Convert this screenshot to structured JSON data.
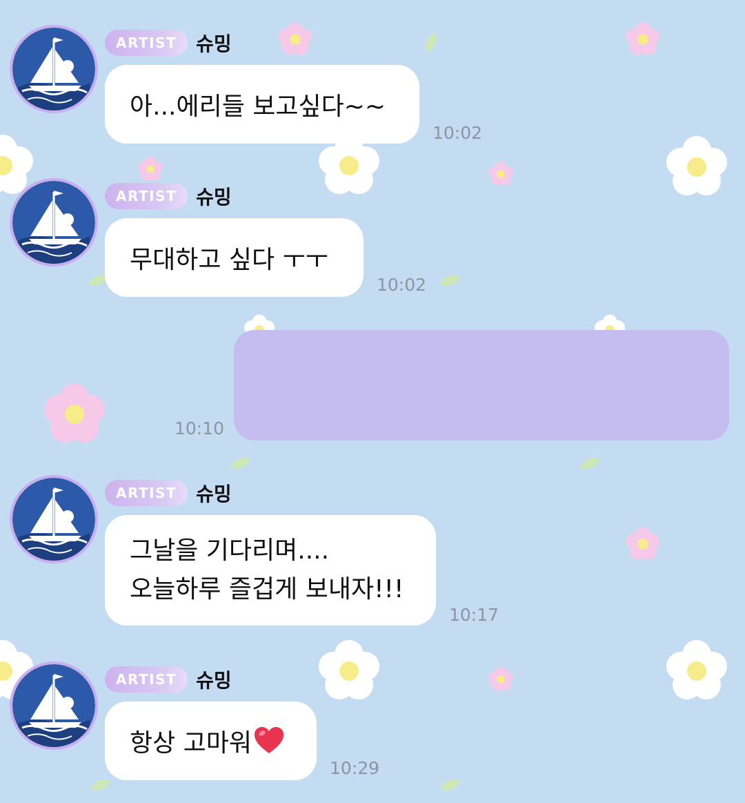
{
  "messages": [
    {
      "badge": "ARTIST",
      "name": "슈밍",
      "lines": [
        "아...에리들 보고싶다~~"
      ],
      "time": "10:02"
    },
    {
      "badge": "ARTIST",
      "name": "슈밍",
      "lines": [
        "무대하고 싶다 ㅜㅜ"
      ],
      "time": "10:02"
    },
    {
      "time": "10:10"
    },
    {
      "badge": "ARTIST",
      "name": "슈밍",
      "lines": [
        "그날을 기다리며....",
        "오늘하루 즐겁게 보내자!!!"
      ],
      "time": "10:17"
    },
    {
      "badge": "ARTIST",
      "name": "슈밍",
      "lines": [
        "항상 고마워"
      ],
      "emoji": "heart-emoji",
      "time": "10:29"
    }
  ],
  "colors": {
    "background": "#c4dcf2",
    "artist_badge": "#cdb2ee",
    "my_bubble": "#c5bdf0",
    "artist_bubble": "#ffffff",
    "timestamp": "#8b94a2"
  },
  "icons": [
    "avatar-ship-icon",
    "heart-emoji",
    "flower-decoration",
    "leaf-decoration"
  ]
}
